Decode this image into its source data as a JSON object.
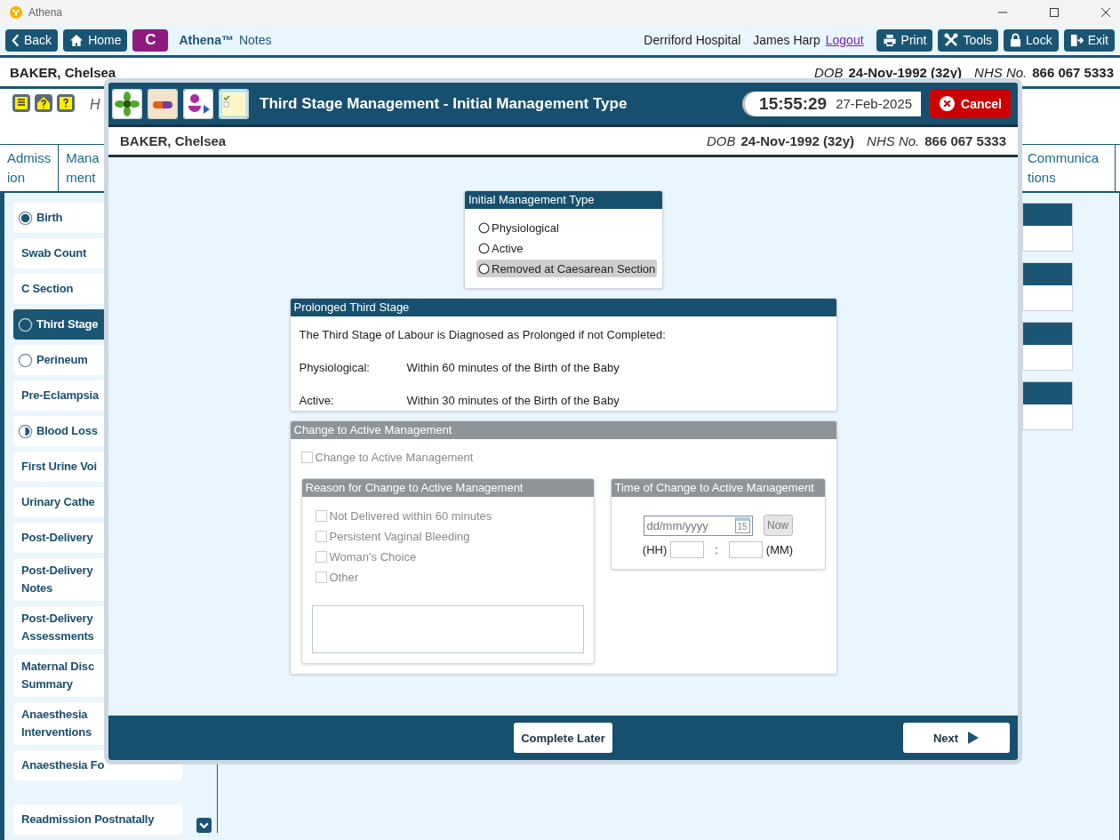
{
  "window": {
    "title": "Athena"
  },
  "toolbar": {
    "nav": [
      {
        "label": "Back",
        "kind": "back"
      },
      {
        "label": "Home",
        "kind": "home"
      },
      {
        "label": "C",
        "kind": "letter"
      }
    ],
    "app_name": "Athena™",
    "app_suffix": "Notes",
    "hospital": "Derriford Hospital",
    "user": "James Harp",
    "logout": "Logout",
    "actions": [
      {
        "label": "Print",
        "kind": "print"
      },
      {
        "label": "Tools",
        "kind": "tools"
      },
      {
        "label": "Lock",
        "kind": "lock"
      },
      {
        "label": "Exit",
        "kind": "exit"
      }
    ]
  },
  "patient": {
    "name": "BAKER, Chelsea",
    "dob_label": "DOB",
    "dob": "24-Nov-1992 (32y)",
    "nhs_label": "NHS No.",
    "nhs": "866 067 5333"
  },
  "header_text": "H",
  "tabs_left": [
    {
      "label": "Admiss\nion"
    },
    {
      "label": "Mana\nment"
    }
  ],
  "tabs_right": [
    {
      "label": "Communica\ntions"
    }
  ],
  "sidebar": {
    "items": [
      {
        "label": "Birth",
        "kind": "complete",
        "selected": false
      },
      {
        "label": "Swab Count",
        "kind": "plain",
        "selected": false
      },
      {
        "label": "C Section",
        "kind": "plain",
        "selected": false
      },
      {
        "label": "Third Stage",
        "kind": "empty",
        "selected": true
      },
      {
        "label": "Perineum",
        "kind": "empty",
        "selected": false
      },
      {
        "label": "Pre-Eclampsia",
        "kind": "plain",
        "selected": false
      },
      {
        "label": "Blood Loss",
        "kind": "partial",
        "selected": false
      },
      {
        "label": "First Urine Voi",
        "kind": "plain",
        "selected": false
      },
      {
        "label": "Urinary Cathe",
        "kind": "plain",
        "selected": false
      },
      {
        "label": "Post-Delivery",
        "kind": "plain",
        "selected": false
      },
      {
        "label": "Post-Delivery\nNotes",
        "kind": "plain",
        "selected": false
      },
      {
        "label": "Post-Delivery\nAssessments",
        "kind": "plain",
        "selected": false
      },
      {
        "label": "Maternal Disc\nSummary",
        "kind": "plain",
        "selected": false
      },
      {
        "label": "Anaesthesia\nInterventions",
        "kind": "plain",
        "selected": false
      },
      {
        "label": "Anaesthesia Fo",
        "kind": "plain",
        "selected": false
      },
      {
        "label": "Readmission Postnatally",
        "kind": "plain",
        "selected": false
      }
    ]
  },
  "dialog": {
    "title": "Third Stage Management - Initial Management Type",
    "time": "15:55:29",
    "date": "27-Feb-2025",
    "cancel": "Cancel",
    "patient": {
      "name": "BAKER, Chelsea",
      "dob_label": "DOB",
      "dob": "24-Nov-1992 (32y)",
      "nhs_label": "NHS No.",
      "nhs": "866 067 5333"
    },
    "initial_management": {
      "title": "Initial Management Type",
      "options": [
        {
          "label": "Physiological",
          "selected": false,
          "focused": false
        },
        {
          "label": "Active",
          "selected": false,
          "focused": false
        },
        {
          "label": "Removed at Caesarean Section",
          "selected": false,
          "focused": true
        }
      ]
    },
    "prolonged": {
      "title": "Prolonged Third Stage",
      "intro": "The Third Stage of Labour is Diagnosed as Prolonged if not Completed:",
      "rows": [
        {
          "label": "Physiological:",
          "text": "Within 60 minutes of the Birth of the Baby"
        },
        {
          "label": "Active:",
          "text": "Within 30 minutes of the Birth of the Baby"
        }
      ]
    },
    "change": {
      "title": "Change to Active Management",
      "disabled": true,
      "checkbox": {
        "label": "Change to Active Management",
        "checked": false
      },
      "reason": {
        "title": "Reason for Change to Active Management",
        "options": [
          {
            "label": "Not Delivered within 60 minutes",
            "checked": false
          },
          {
            "label": "Persistent Vaginal Bleeding",
            "checked": false
          },
          {
            "label": "Woman's Choice",
            "checked": false
          },
          {
            "label": "Other",
            "checked": false
          }
        ]
      },
      "time": {
        "title": "Time of Change to Active Management",
        "date_placeholder": "dd/mm/yyyy",
        "calendar_day": "15",
        "now": "Now",
        "hh": "(HH)",
        "separator": ":",
        "mm": "(MM)"
      }
    },
    "footer": {
      "complete_later": "Complete Later",
      "next": "Next"
    }
  }
}
